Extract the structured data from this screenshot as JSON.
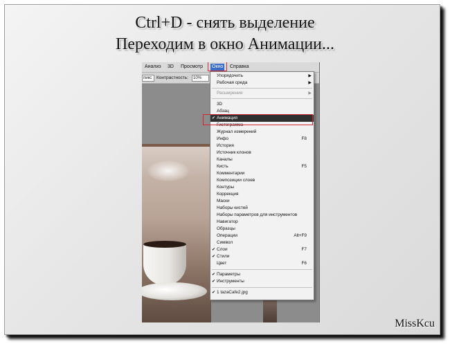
{
  "slide": {
    "title_line1": "Ctrl+D - снять выделение",
    "title_line2": "Переходим в окно Анимации...",
    "signature": "MissKcu"
  },
  "menubar": {
    "items": [
      "Анализ",
      "3D",
      "Просмотр",
      "Окно",
      "Справка"
    ],
    "active": "Окно"
  },
  "options_bar": {
    "field_value": "пикс",
    "contrast_label": "Контрастность:",
    "contrast_value": "10%"
  },
  "window_menu": {
    "items": [
      {
        "label": "Упорядочить",
        "shortcut": "",
        "submenu": true,
        "checked": false,
        "disabled": false
      },
      {
        "label": "Рабочая среда",
        "shortcut": "",
        "submenu": true,
        "checked": false,
        "disabled": false
      },
      {
        "label": "Расширения",
        "shortcut": "",
        "submenu": true,
        "checked": false,
        "disabled": true
      },
      {
        "label": "3D",
        "shortcut": "",
        "submenu": false,
        "checked": false,
        "disabled": false
      },
      {
        "label": "Абзац",
        "shortcut": "",
        "submenu": false,
        "checked": false,
        "disabled": false
      },
      {
        "label": "Анимация",
        "shortcut": "",
        "submenu": false,
        "checked": true,
        "disabled": false,
        "selected": true
      },
      {
        "label": "Гистограмма",
        "shortcut": "",
        "submenu": false,
        "checked": false,
        "disabled": false
      },
      {
        "label": "Журнал измерений",
        "shortcut": "",
        "submenu": false,
        "checked": false,
        "disabled": false
      },
      {
        "label": "Инфо",
        "shortcut": "F8",
        "submenu": false,
        "checked": false,
        "disabled": false
      },
      {
        "label": "История",
        "shortcut": "",
        "submenu": false,
        "checked": false,
        "disabled": false
      },
      {
        "label": "Источник клонов",
        "shortcut": "",
        "submenu": false,
        "checked": false,
        "disabled": false
      },
      {
        "label": "Каналы",
        "shortcut": "",
        "submenu": false,
        "checked": false,
        "disabled": false
      },
      {
        "label": "Кисть",
        "shortcut": "F5",
        "submenu": false,
        "checked": false,
        "disabled": false
      },
      {
        "label": "Комментарии",
        "shortcut": "",
        "submenu": false,
        "checked": false,
        "disabled": false
      },
      {
        "label": "Композиции слоев",
        "shortcut": "",
        "submenu": false,
        "checked": false,
        "disabled": false
      },
      {
        "label": "Контуры",
        "shortcut": "",
        "submenu": false,
        "checked": false,
        "disabled": false
      },
      {
        "label": "Коррекция",
        "shortcut": "",
        "submenu": false,
        "checked": false,
        "disabled": false
      },
      {
        "label": "Маски",
        "shortcut": "",
        "submenu": false,
        "checked": false,
        "disabled": false
      },
      {
        "label": "Наборы кистей",
        "shortcut": "",
        "submenu": false,
        "checked": false,
        "disabled": false
      },
      {
        "label": "Наборы параметров для инструментов",
        "shortcut": "",
        "submenu": false,
        "checked": false,
        "disabled": false
      },
      {
        "label": "Навигатор",
        "shortcut": "",
        "submenu": false,
        "checked": false,
        "disabled": false
      },
      {
        "label": "Образцы",
        "shortcut": "",
        "submenu": false,
        "checked": false,
        "disabled": false
      },
      {
        "label": "Операции",
        "shortcut": "Alt+F9",
        "submenu": false,
        "checked": false,
        "disabled": false
      },
      {
        "label": "Символ",
        "shortcut": "",
        "submenu": false,
        "checked": false,
        "disabled": false
      },
      {
        "label": "Слои",
        "shortcut": "F7",
        "submenu": false,
        "checked": true,
        "disabled": false
      },
      {
        "label": "Стили",
        "shortcut": "",
        "submenu": false,
        "checked": true,
        "disabled": false
      },
      {
        "label": "Цвет",
        "shortcut": "F6",
        "submenu": false,
        "checked": false,
        "disabled": false
      },
      {
        "label": "Параметры",
        "shortcut": "",
        "submenu": false,
        "checked": true,
        "disabled": false
      },
      {
        "label": "Инструменты",
        "shortcut": "",
        "submenu": false,
        "checked": true,
        "disabled": false
      },
      {
        "label": "1 tazaCafe2.jpg",
        "shortcut": "",
        "submenu": false,
        "checked": true,
        "disabled": false
      }
    ],
    "checkmark_glyph": "✔",
    "submenu_glyph": "▶"
  },
  "colors": {
    "highlight_border": "#d3252b",
    "menu_selected_bg": "#2f2f2f",
    "menubar_active_bg": "#3a6ec9"
  }
}
